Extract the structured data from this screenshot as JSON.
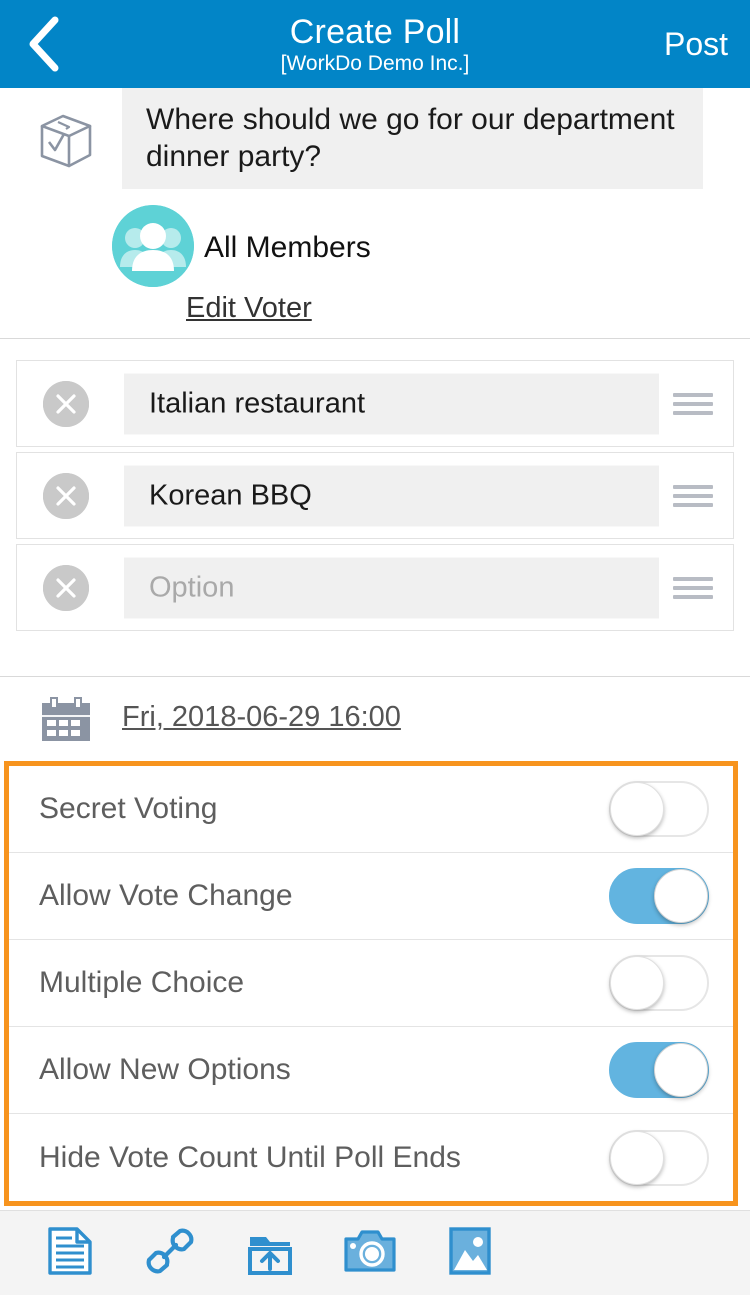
{
  "header": {
    "back_icon": "chevron-left-icon",
    "title": "Create Poll",
    "subtitle": "[WorkDo Demo Inc.]",
    "post_label": "Post",
    "background_color": "#0285c7"
  },
  "question": {
    "icon": "ballot-box-icon",
    "text": "Where should we go for our department dinner party?",
    "field_background": "#f0f0f0"
  },
  "voter": {
    "avatar_icon": "group-members-avatar-icon",
    "avatar_color": "#5ed2d6",
    "label": "All Members",
    "edit_link": "Edit Voter"
  },
  "options": [
    {
      "value": "Italian restaurant",
      "placeholder": "Option",
      "delete_icon": "close-circle-icon",
      "drag_icon": "drag-handle-icon"
    },
    {
      "value": "Korean BBQ",
      "placeholder": "Option",
      "delete_icon": "close-circle-icon",
      "drag_icon": "drag-handle-icon"
    },
    {
      "value": "",
      "placeholder": "Option",
      "delete_icon": "close-circle-icon",
      "drag_icon": "drag-handle-icon"
    }
  ],
  "deadline": {
    "icon": "calendar-icon",
    "text": "Fri, 2018-06-29 16:00"
  },
  "settings": {
    "highlight_color": "#f7941e",
    "toggle_on_color": "#62b4e0",
    "items": [
      {
        "label": "Secret Voting",
        "state": "off"
      },
      {
        "label": "Allow Vote Change",
        "state": "on"
      },
      {
        "label": "Multiple Choice",
        "state": "off"
      },
      {
        "label": "Allow New Options",
        "state": "on"
      },
      {
        "label": "Hide Vote Count Until Poll Ends",
        "state": "off"
      }
    ]
  },
  "toolbar": {
    "accent_color": "#2f8fce",
    "items": [
      {
        "icon": "document-icon"
      },
      {
        "icon": "link-icon"
      },
      {
        "icon": "upload-folder-icon"
      },
      {
        "icon": "camera-icon"
      },
      {
        "icon": "image-icon"
      }
    ]
  }
}
